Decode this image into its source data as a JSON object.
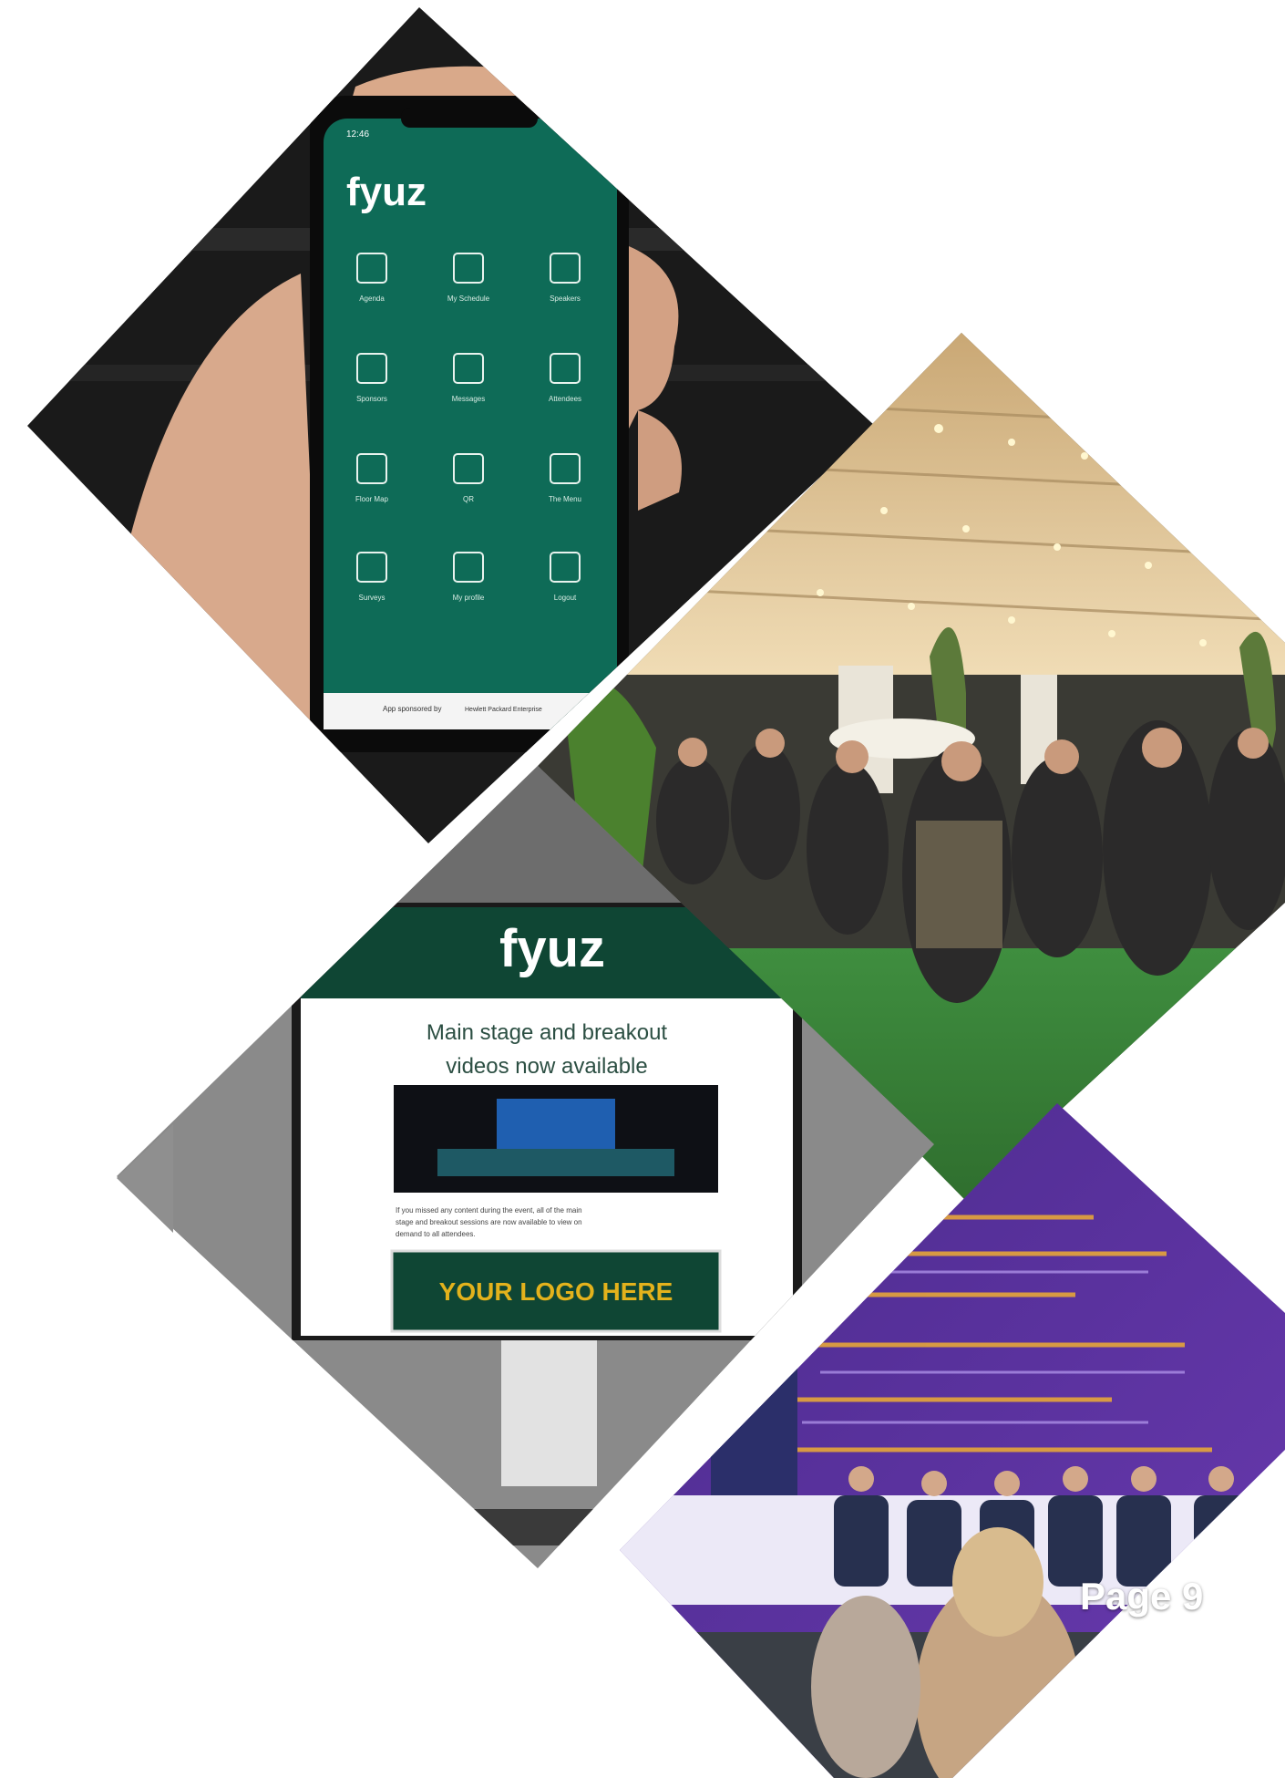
{
  "header": {
    "wordmark": ""
  },
  "phone_app": {
    "logo": "fyuz",
    "status_time": "12:46",
    "menu": [
      {
        "label": "Agenda",
        "icon": "calendar-icon"
      },
      {
        "label": "My Schedule",
        "icon": "document-icon"
      },
      {
        "label": "Speakers",
        "icon": "microphone-icon"
      },
      {
        "label": "Sponsors",
        "icon": "handshake-icon"
      },
      {
        "label": "Messages",
        "icon": "chat-icon"
      },
      {
        "label": "Attendees",
        "icon": "people-icon"
      },
      {
        "label": "Floor Map",
        "icon": "map-icon"
      },
      {
        "label": "QR",
        "icon": "qr-code-icon"
      },
      {
        "label": "The Menu",
        "icon": "dining-icon"
      },
      {
        "label": "Surveys",
        "icon": "list-icon"
      },
      {
        "label": "My profile",
        "icon": "user-icon"
      },
      {
        "label": "Logout",
        "icon": "logout-icon"
      }
    ],
    "sponsor_text": "App sponsored by",
    "sponsor_logo_text": "Hewlett Packard Enterprise"
  },
  "email_mock": {
    "logo": "fyuz",
    "headline_1": "Main stage and breakout",
    "headline_2": "videos now available",
    "body_1": "If you missed any content during the event, all of the main",
    "body_2": "stage and breakout sessions are now available to view on",
    "body_3": "demand to all attendees.",
    "cta": "YOUR LOGO HERE"
  },
  "footer": {
    "page": "Page 9"
  },
  "colors": {
    "app_green": "#0e6b57",
    "email_dark_green": "#0f4634",
    "logo_gold": "#e3b21c",
    "stage_purple": "#5a2f9c"
  }
}
